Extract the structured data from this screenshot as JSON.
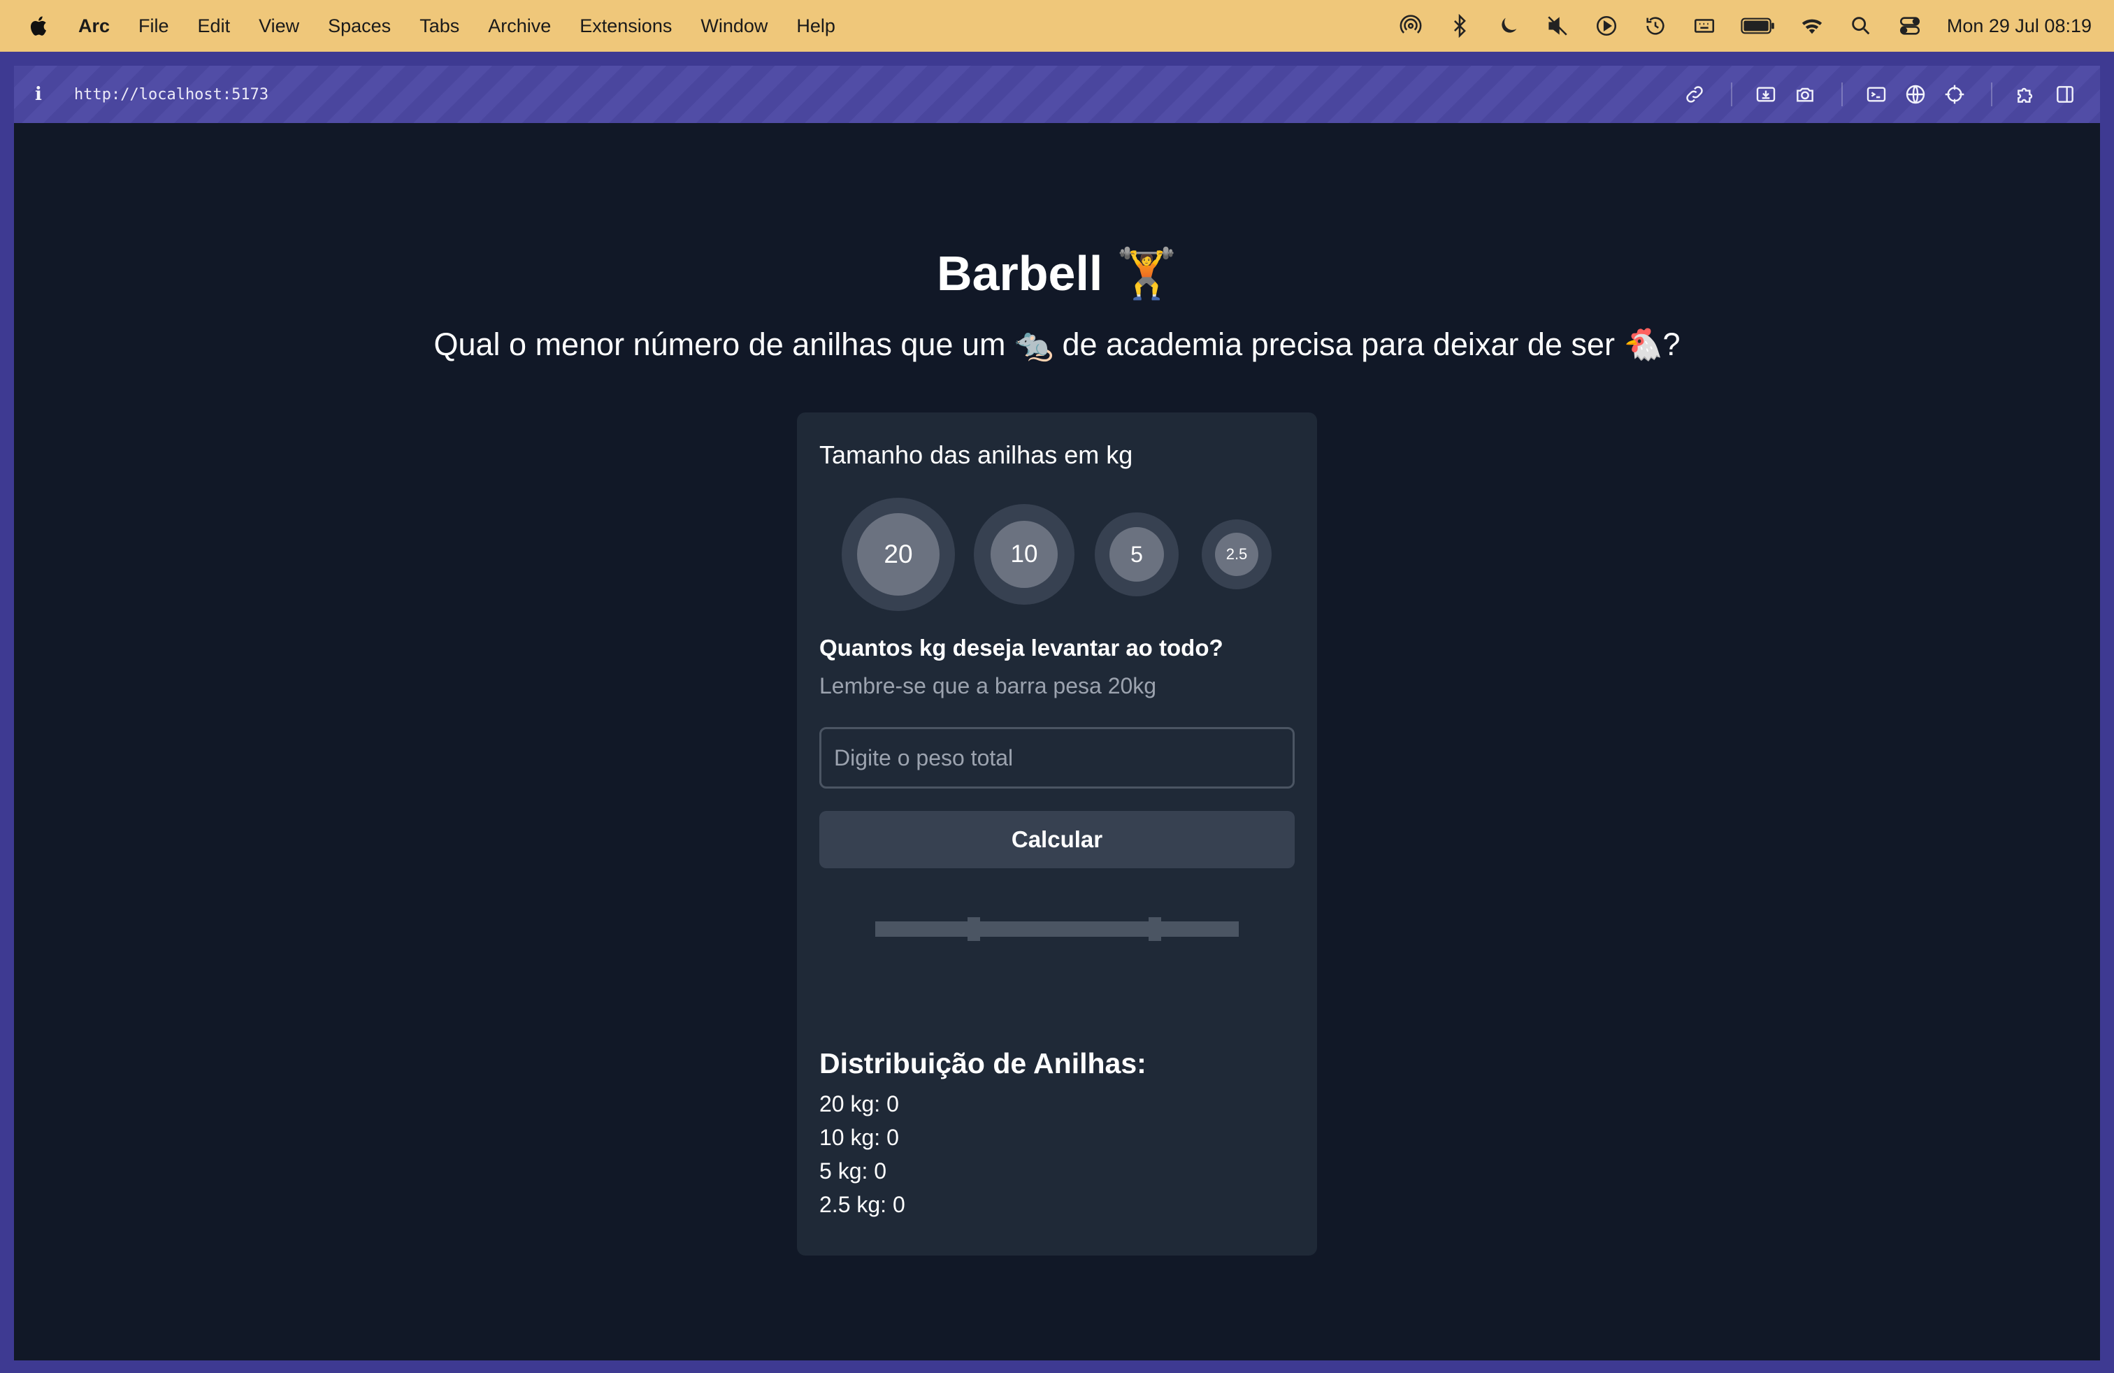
{
  "menubar": {
    "app_name": "Arc",
    "items": [
      "File",
      "Edit",
      "View",
      "Spaces",
      "Tabs",
      "Archive",
      "Extensions",
      "Window",
      "Help"
    ],
    "clock": "Mon 29 Jul  08:19",
    "status_icons": [
      "airdrop-icon",
      "bluetooth-icon",
      "moon-icon",
      "mute-icon",
      "play-icon",
      "time-machine-icon",
      "keyboard-icon",
      "battery-icon",
      "wifi-icon",
      "search-icon",
      "control-center-icon"
    ]
  },
  "browser": {
    "url": "http://localhost:5173",
    "toolbar_icons": [
      "link-icon",
      "capture-icon",
      "camera-icon",
      "terminal-icon",
      "globe-icon",
      "crosshair-icon",
      "extensions-icon",
      "split-view-icon"
    ]
  },
  "page": {
    "title": "Barbell 🏋️",
    "subtitle": "Qual o menor número de anilhas que um 🐀 de academia precisa para deixar de ser 🐔?"
  },
  "card": {
    "plates_heading": "Tamanho das anilhas em kg",
    "plates": [
      "20",
      "10",
      "5",
      "2.5"
    ],
    "question": "Quantos kg deseja levantar ao todo?",
    "hint": "Lembre-se que a barra pesa 20kg",
    "input_placeholder": "Digite o peso total",
    "input_value": "",
    "button_label": "Calcular",
    "distribution_title": "Distribuição de Anilhas:",
    "distribution": [
      {
        "label": "20 kg: 0"
      },
      {
        "label": "10 kg: 0"
      },
      {
        "label": "5 kg: 0"
      },
      {
        "label": "2.5 kg: 0"
      }
    ]
  },
  "colors": {
    "menubar_bg": "#efc77a",
    "window_frame": "#3e3a92",
    "page_bg": "#111827",
    "card_bg": "#1f2937",
    "plate_ring": "#374151",
    "plate_core": "#6b7280",
    "muted_text": "#9ca3af"
  }
}
